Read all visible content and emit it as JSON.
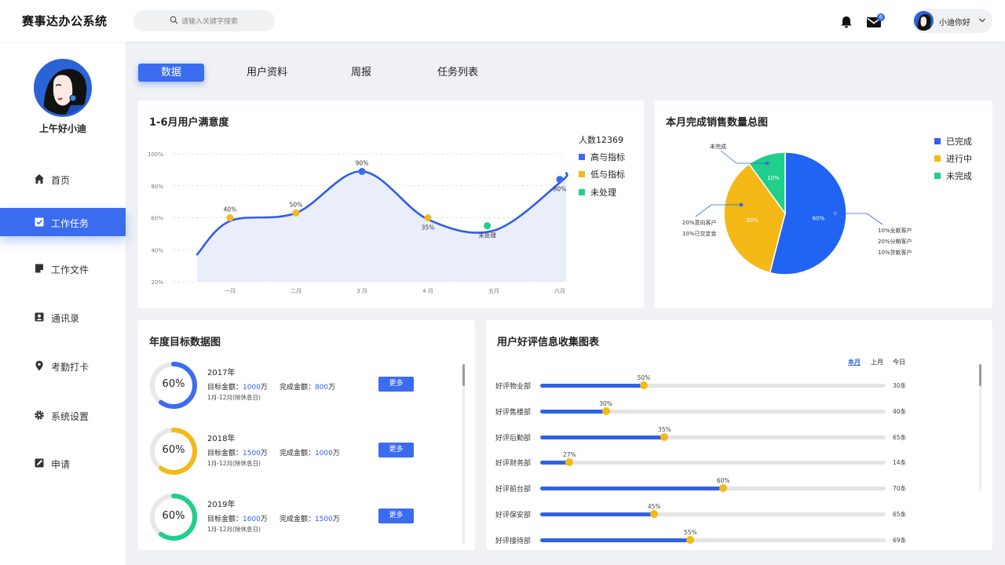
{
  "app": {
    "title": "赛事达办公系统"
  },
  "search": {
    "placeholder": "请输入关键字搜索"
  },
  "header": {
    "mail_badge": "6",
    "user_name": "小迪你好"
  },
  "sidebar": {
    "greeting": "上午好小迪",
    "items": [
      {
        "label": "首页",
        "icon": "home-icon"
      },
      {
        "label": "工作任务",
        "icon": "task-check-icon",
        "active": true
      },
      {
        "label": "工作文件",
        "icon": "document-icon"
      },
      {
        "label": "通讯录",
        "icon": "contacts-icon"
      },
      {
        "label": "考勤打卡",
        "icon": "location-pin-icon"
      },
      {
        "label": "系统设置",
        "icon": "gear-icon"
      },
      {
        "label": "申请",
        "icon": "edit-icon"
      }
    ]
  },
  "tabs": [
    {
      "label": "数据",
      "active": true
    },
    {
      "label": "用户资料"
    },
    {
      "label": "周报"
    },
    {
      "label": "任务列表"
    }
  ],
  "satisfaction": {
    "title": "1-6月用户满意度",
    "legend_title": "人数12369",
    "legend": [
      {
        "label": "高与指标",
        "color": "#3b6cf0"
      },
      {
        "label": "低与指标",
        "color": "#f4b916"
      },
      {
        "label": "未处理",
        "color": "#1fcf8a"
      }
    ]
  },
  "sales": {
    "title": "本月完成销售数量总图",
    "legend": [
      {
        "label": "已完成",
        "color": "#2f62e6"
      },
      {
        "label": "进行中",
        "color": "#f4b916"
      },
      {
        "label": "未完成",
        "color": "#1fcf8a"
      }
    ],
    "annotations": {
      "top": "未完成",
      "left_line1": "20%意向客户",
      "left_line2": "10%已交定金",
      "right_line1": "10%全款客户",
      "right_line2": "20%分期客户",
      "right_line3": "10%贷款客户"
    }
  },
  "annual": {
    "title": "年度目标数据图",
    "target_label": "目标金额：",
    "done_label": "完成金额：",
    "unit": "万",
    "range_note": "1月-12月(除休息日)",
    "more_label": "更多",
    "goals": [
      {
        "year": "2017年",
        "percent": "60%",
        "progress": 0.6,
        "target": "1000",
        "done": "800",
        "color": "#3b6cf0"
      },
      {
        "year": "2018年",
        "percent": "60%",
        "progress": 0.6,
        "target": "1500",
        "done": "1000",
        "color": "#f4b916"
      },
      {
        "year": "2019年",
        "percent": "60%",
        "progress": 0.6,
        "target": "1600",
        "done": "1500",
        "color": "#1fcf8a"
      }
    ]
  },
  "reviews": {
    "title": "用户好评信息收集图表",
    "periods": [
      {
        "label": "本月",
        "active": true
      },
      {
        "label": "上月"
      },
      {
        "label": "今日"
      }
    ],
    "rows": [
      {
        "label": "好评物业部",
        "pct": "50%",
        "value": 0.3,
        "count": "30条"
      },
      {
        "label": "好评售楼部",
        "pct": "30%",
        "value": 0.19,
        "count": "40条"
      },
      {
        "label": "好评后勤部",
        "pct": "35%",
        "value": 0.36,
        "count": "65条"
      },
      {
        "label": "好评财务部",
        "pct": "27%",
        "value": 0.085,
        "count": "14条"
      },
      {
        "label": "好评前台部",
        "pct": "60%",
        "value": 0.53,
        "count": "70条"
      },
      {
        "label": "好评保安部",
        "pct": "45%",
        "value": 0.33,
        "count": "65条"
      },
      {
        "label": "好评接待部",
        "pct": "55%",
        "value": 0.435,
        "count": "69条"
      }
    ]
  },
  "chart_data": [
    {
      "type": "area",
      "title": "1-6月用户满意度",
      "categories": [
        "一月",
        "二月",
        "3 月",
        "4 月",
        "五月",
        "六月"
      ],
      "y_ticks": [
        "20%",
        "40%",
        "60%",
        "80%",
        "100%"
      ],
      "ylim": [
        20,
        100
      ],
      "curve": [
        [
          0.5,
          37
        ],
        [
          1,
          58
        ],
        [
          2,
          63
        ],
        [
          3,
          89
        ],
        [
          4,
          59
        ],
        [
          5,
          52
        ],
        [
          6,
          82
        ],
        [
          6.1,
          88
        ]
      ],
      "points": [
        {
          "x": 1,
          "y": 60,
          "label": "40%",
          "color": "#f4b916",
          "label_pos": "above"
        },
        {
          "x": 2,
          "y": 63,
          "label": "50%",
          "color": "#f4b916",
          "label_pos": "above"
        },
        {
          "x": 3,
          "y": 89,
          "label": "90%",
          "color": "#3b6cf0",
          "label_pos": "above"
        },
        {
          "x": 4,
          "y": 60,
          "label": "35%",
          "color": "#f4b916",
          "label_pos": "below"
        },
        {
          "x": 4.9,
          "y": 55,
          "label": "未处理",
          "color": "#1fcf8a",
          "label_pos": "below"
        },
        {
          "x": 6,
          "y": 84,
          "label": "80%",
          "color": "#3b6cf0",
          "label_pos": "below"
        }
      ],
      "legend_placement": "top-right",
      "grid": true
    },
    {
      "type": "pie",
      "title": "本月完成销售数量总图",
      "slices": [
        {
          "name": "已完成",
          "value": 54,
          "label": "60%",
          "color": "#1f64f2"
        },
        {
          "name": "进行中",
          "value": 36,
          "label": "30%",
          "color": "#f4b916"
        },
        {
          "name": "未完成",
          "value": 10,
          "label": "10%",
          "color": "#1fcf8a"
        }
      ],
      "legend_placement": "top-right"
    }
  ]
}
